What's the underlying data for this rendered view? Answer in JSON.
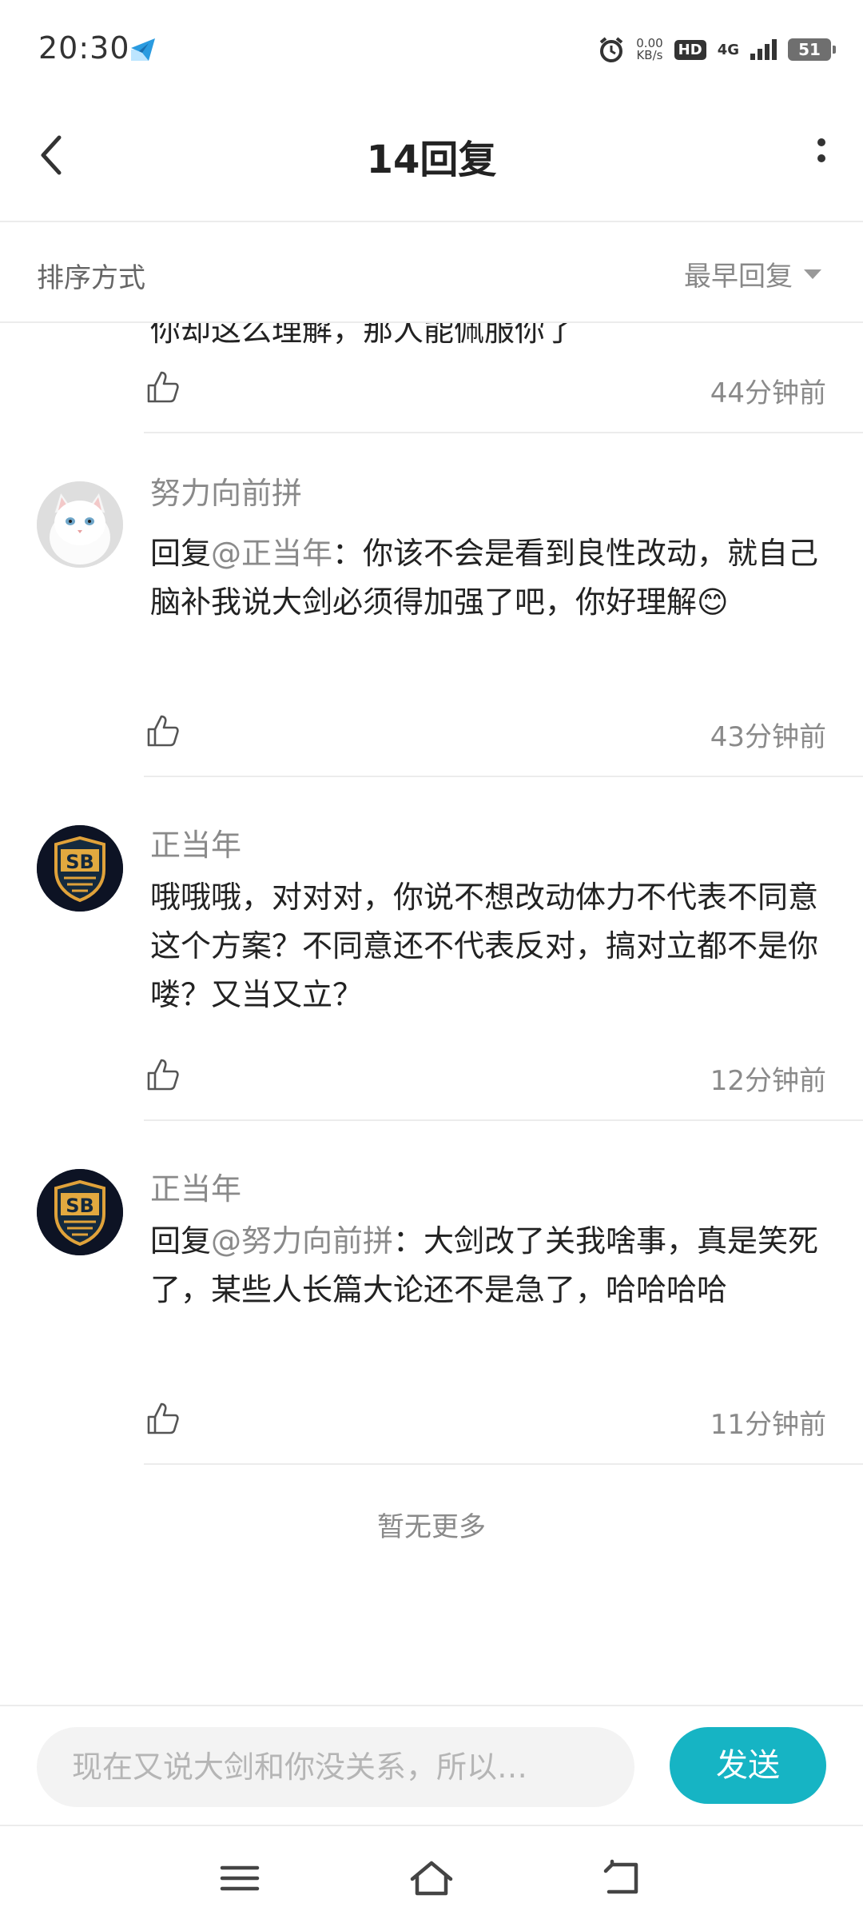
{
  "status_bar": {
    "time": "20:30",
    "speed_value": "0.00",
    "speed_unit": "KB/s",
    "hd": "HD",
    "network": "4G",
    "battery": "51"
  },
  "header": {
    "title": "14回复"
  },
  "sort": {
    "label": "排序方式",
    "value": "最早回复"
  },
  "partial_reply": {
    "text": "你却这么理解，那人能佩服你了",
    "time": "44分钟前"
  },
  "replies": [
    {
      "author": "努力向前拼",
      "prefix": "回复",
      "mention": "@正当年",
      "text": "：你该不会是看到良性改动，就自己脑补我说大剑必须得加强了吧，你好理解😊",
      "time": "43分钟前",
      "avatar": "white-cat"
    },
    {
      "author": "正当年",
      "prefix": "",
      "mention": "",
      "text": "哦哦哦，对对对，你说不想改动体力不代表不同意这个方案？不同意还不代表反对，搞对立都不是你喽？又当又立？",
      "time": "12分钟前",
      "avatar": "sb-shield"
    },
    {
      "author": "正当年",
      "prefix": "回复",
      "mention": "@努力向前拼",
      "text": "：大剑改了关我啥事，真是笑死了，某些人长篇大论还不是急了，哈哈哈哈",
      "time": "11分钟前",
      "avatar": "sb-shield"
    }
  ],
  "footer_text": "暂无更多",
  "input": {
    "placeholder": "现在又说大剑和你没关系，所以…"
  },
  "send_label": "发送",
  "colors": {
    "accent": "#16b4c4",
    "muted": "#8a8a8a"
  }
}
